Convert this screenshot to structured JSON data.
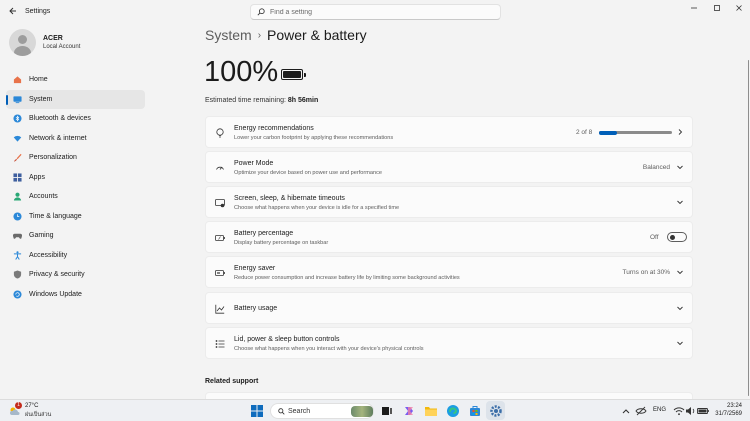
{
  "app": {
    "title": "Settings"
  },
  "search": {
    "placeholder": "Find a setting"
  },
  "user": {
    "name": "ACER",
    "account_type": "Local Account"
  },
  "sidebar": {
    "items": [
      {
        "label": "Home",
        "icon": "home-icon",
        "color": "#e8734a"
      },
      {
        "label": "System",
        "icon": "system-icon",
        "color": "#2b88d8",
        "active": true
      },
      {
        "label": "Bluetooth & devices",
        "icon": "bluetooth-icon",
        "color": "#2b88d8"
      },
      {
        "label": "Network & internet",
        "icon": "wifi-icon",
        "color": "#2b88d8"
      },
      {
        "label": "Personalization",
        "icon": "brush-icon",
        "color": "#e8734a"
      },
      {
        "label": "Apps",
        "icon": "apps-icon",
        "color": "#3f5f9f"
      },
      {
        "label": "Accounts",
        "icon": "accounts-icon",
        "color": "#2aa876"
      },
      {
        "label": "Time & language",
        "icon": "globe-clock-icon",
        "color": "#2b88d8"
      },
      {
        "label": "Gaming",
        "icon": "gamepad-icon",
        "color": "#6b6b6b"
      },
      {
        "label": "Accessibility",
        "icon": "accessibility-icon",
        "color": "#2b88d8"
      },
      {
        "label": "Privacy & security",
        "icon": "shield-icon",
        "color": "#6b6b6b"
      },
      {
        "label": "Windows Update",
        "icon": "update-icon",
        "color": "#2b88d8"
      }
    ]
  },
  "breadcrumb": {
    "parent": "System",
    "separator": "›",
    "current": "Power & battery"
  },
  "battery": {
    "percent_text": "100%",
    "level": 1.0,
    "estimate_label": "Estimated time remaining:",
    "estimate_value": "8h 56min"
  },
  "cards": {
    "energy_recommendations": {
      "title": "Energy recommendations",
      "description": "Lower your carbon footprint by applying these recommendations",
      "value": "2 of 8",
      "progress": 0.25
    },
    "power_mode": {
      "title": "Power Mode",
      "description": "Optimize your device based on power use and performance",
      "value": "Balanced"
    },
    "screen_sleep": {
      "title": "Screen, sleep, & hibernate timeouts",
      "description": "Choose what happens when your device is idle for a specified time"
    },
    "battery_percentage": {
      "title": "Battery percentage",
      "description": "Display battery percentage on taskbar",
      "value": "Off",
      "toggle_on": false
    },
    "energy_saver": {
      "title": "Energy saver",
      "description": "Reduce power consumption and increase battery life by limiting some background activities",
      "value": "Turns on at 30%"
    },
    "battery_usage": {
      "title": "Battery usage"
    },
    "lid_power": {
      "title": "Lid, power & sleep button controls",
      "description": "Choose what happens when you interact with your device's physical controls"
    }
  },
  "related": {
    "title": "Related support"
  },
  "taskbar": {
    "weather": {
      "temp": "27°C",
      "desc": "ฝนเป็นส่วน",
      "badge": "1"
    },
    "search_label": "Search",
    "tray": {
      "language": "ENG"
    },
    "clock": {
      "time": "23:24",
      "date": "31/7/2569"
    }
  },
  "colors": {
    "accent": "#005fb8",
    "background": "#f3f3f3",
    "card": "#fbfbfb"
  }
}
